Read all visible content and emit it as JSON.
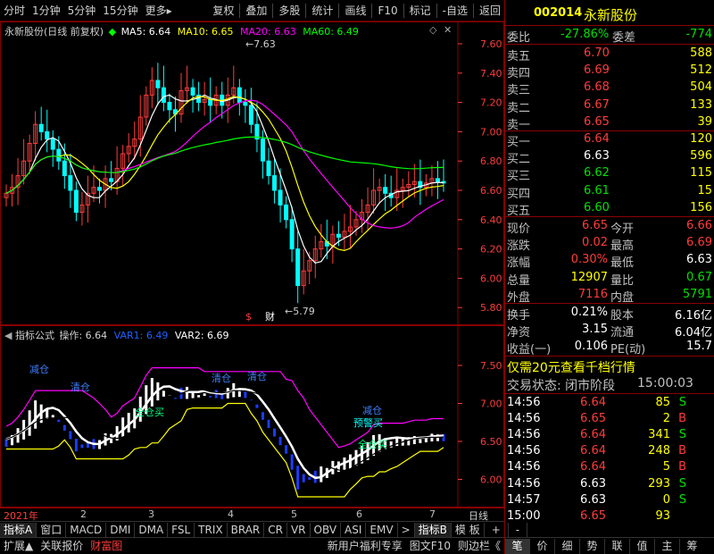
{
  "toolbar": {
    "tabs": [
      "分时",
      "1分钟",
      "5分钟",
      "15分钟",
      "更多"
    ],
    "more_arrow": "▸",
    "actions": [
      "复权",
      "叠加",
      "多股",
      "统计",
      "画线",
      "F10",
      "标记",
      "-自选",
      "返回"
    ]
  },
  "main_chart": {
    "title": "永新股份(日线 前复权)",
    "ma": [
      {
        "label": "MA5: 6.64",
        "color": "#ffffff"
      },
      {
        "label": "MA10: 6.65",
        "color": "#ffff00"
      },
      {
        "label": "MA20: 6.63",
        "color": "#ff00ff"
      },
      {
        "label": "MA60: 6.49",
        "color": "#00ff00"
      }
    ],
    "price_axis": [
      "7.60",
      "7.40",
      "7.20",
      "7.00",
      "6.80",
      "6.60",
      "6.40",
      "6.20",
      "6.00",
      "5.80"
    ],
    "high_marker": "7.63",
    "low_marker": "5.79",
    "event_markers": [
      "$",
      "财"
    ]
  },
  "indicator": {
    "title": "指标公式",
    "op_label": "操作: 6.64",
    "var1": "VAR1: 6.49",
    "var2": "VAR2: 6.69",
    "axis": [
      "7.50",
      "7.00",
      "6.50",
      "6.00"
    ],
    "annotations": [
      "减仓",
      "清仓",
      "清仓",
      "清仓",
      "全仓买",
      "减仓",
      "预警买",
      "全仓买"
    ]
  },
  "date_axis": [
    "2021年",
    "2",
    "3",
    "4",
    "5",
    "6",
    "7"
  ],
  "period_label": "日线",
  "indicator_tabs": [
    "指标A",
    "窗口",
    "MACD",
    "DMI",
    "DMA",
    "FSL",
    "TRIX",
    "BRAR",
    "CR",
    "VR",
    "OBV",
    "ASI",
    "EMV",
    ">",
    "指标B",
    "模 板",
    "+",
    "-"
  ],
  "bottom": {
    "left": [
      "扩展▲",
      "关联报价",
      "财富图"
    ],
    "middle": [
      "新用户福利专享",
      "图文F10",
      "则边栏《"
    ],
    "right_tabs": [
      "笔",
      "价",
      "细",
      "势",
      "联",
      "值",
      "主",
      "筹"
    ]
  },
  "quote": {
    "code": "002014",
    "name": "永新股份",
    "webi_label": "委比",
    "webi_value": "-27.86%",
    "wecha_label": "委差",
    "wecha_value": "-774",
    "asks": [
      {
        "label": "卖五",
        "price": "6.70",
        "vol": "588"
      },
      {
        "label": "卖四",
        "price": "6.69",
        "vol": "512"
      },
      {
        "label": "卖三",
        "price": "6.68",
        "vol": "504"
      },
      {
        "label": "卖二",
        "price": "6.67",
        "vol": "133"
      },
      {
        "label": "卖一",
        "price": "6.65",
        "vol": "39"
      }
    ],
    "bids": [
      {
        "label": "买一",
        "price": "6.64",
        "vol": "120"
      },
      {
        "label": "买二",
        "price": "6.63",
        "vol": "596"
      },
      {
        "label": "买三",
        "price": "6.62",
        "vol": "115"
      },
      {
        "label": "买四",
        "price": "6.61",
        "vol": "15"
      },
      {
        "label": "买五",
        "price": "6.60",
        "vol": "156"
      }
    ],
    "stats": [
      {
        "l1": "现价",
        "v1": "6.65",
        "l2": "今开",
        "v2": "6.66"
      },
      {
        "l1": "涨跌",
        "v1": "0.02",
        "l2": "最高",
        "v2": "6.69"
      },
      {
        "l1": "涨幅",
        "v1": "0.30%",
        "l2": "最低",
        "v2": "6.63"
      },
      {
        "l1": "总量",
        "v1": "12907",
        "l2": "量比",
        "v2": "0.67"
      },
      {
        "l1": "外盘",
        "v1": "7116",
        "l2": "内盘",
        "v2": "5791"
      }
    ],
    "stats2": [
      {
        "l1": "换手",
        "v1": "0.21%",
        "l2": "股本",
        "v2": "6.16亿"
      },
      {
        "l1": "净资",
        "v1": "3.15",
        "l2": "流通",
        "v2": "6.04亿"
      },
      {
        "l1": "收益(一)",
        "v1": "0.106",
        "l2": "PE(动)",
        "v2": "15.7"
      }
    ],
    "promo": "仅需20元查看千档行情",
    "status_label": "交易状态: 闭市阶段",
    "status_time": "15:00:03",
    "ticks": [
      {
        "time": "14:56",
        "price": "6.64",
        "vol": "85",
        "side": "S"
      },
      {
        "time": "14:56",
        "price": "6.65",
        "vol": "2",
        "side": "B"
      },
      {
        "time": "14:56",
        "price": "6.64",
        "vol": "341",
        "side": "S"
      },
      {
        "time": "14:56",
        "price": "6.64",
        "vol": "248",
        "side": "B"
      },
      {
        "time": "14:56",
        "price": "6.64",
        "vol": "5",
        "side": "B"
      },
      {
        "time": "14:56",
        "price": "6.63",
        "vol": "293",
        "side": "S"
      },
      {
        "time": "14:57",
        "price": "6.63",
        "vol": "0",
        "side": "S"
      },
      {
        "time": "15:00",
        "price": "6.65",
        "vol": "93",
        "side": ""
      }
    ]
  }
}
